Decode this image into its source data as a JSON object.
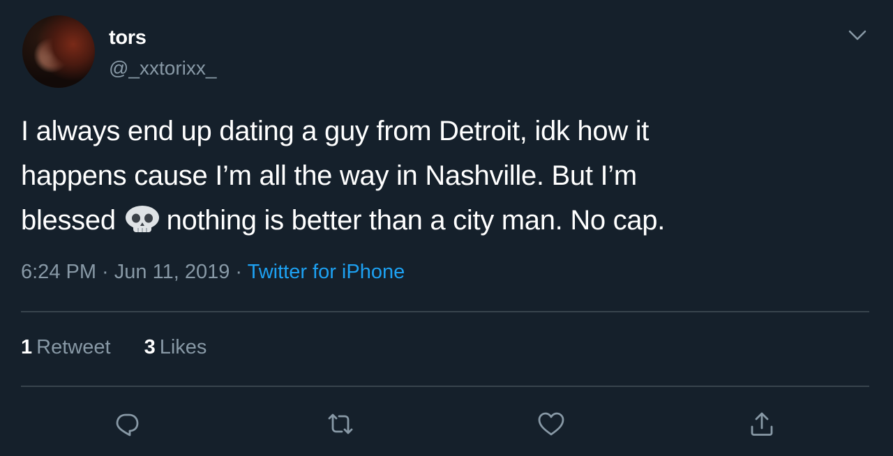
{
  "user": {
    "display_name": "tors",
    "handle": "@_xxtorixx_"
  },
  "tweet": {
    "text_part1": "I always end up dating a guy from Detroit, idk how it\nhappens cause I’m all the way in Nashville. But I’m\nblessed ",
    "emoji": "skull-emoji",
    "text_part2": "nothing is better than a city man. No cap.",
    "time": "6:24 PM",
    "separator": " · ",
    "date": "Jun 11, 2019",
    "source": "Twitter for iPhone"
  },
  "stats": {
    "retweets_count": "1",
    "retweets_label": "Retweet",
    "likes_count": "3",
    "likes_label": "Likes"
  },
  "actions": [
    "reply-icon",
    "retweet-icon",
    "like-icon",
    "share-icon"
  ],
  "colors": {
    "background": "#15202b",
    "text": "#ffffff",
    "secondary": "#8899a6",
    "accent": "#1da1f2",
    "divider": "#38444d"
  }
}
